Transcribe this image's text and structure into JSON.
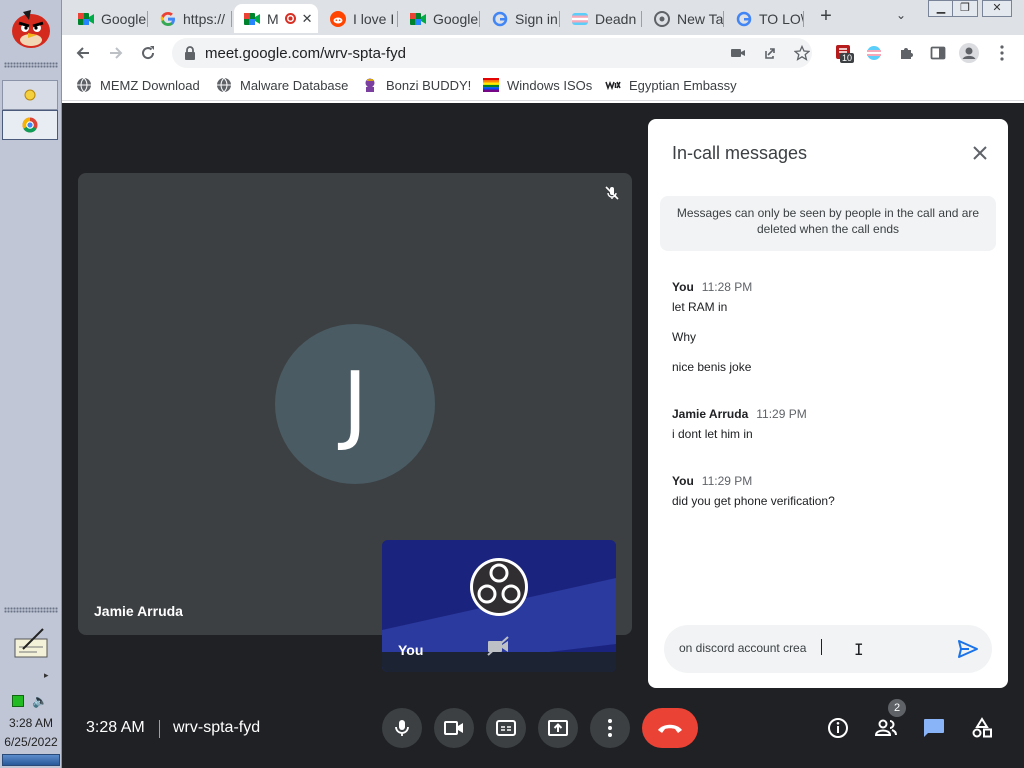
{
  "browser": {
    "tabs": [
      {
        "title": "Google",
        "favicon": "google-meet-icon"
      },
      {
        "title": "https://",
        "favicon": "google-g-icon"
      },
      {
        "title": "M",
        "favicon": "google-meet-icon",
        "active": true,
        "recording": true
      },
      {
        "title": "I love I",
        "favicon": "reddit-icon"
      },
      {
        "title": "Google",
        "favicon": "google-meet-icon"
      },
      {
        "title": "Sign in",
        "favicon": "google-g-icon"
      },
      {
        "title": "Deadn",
        "favicon": "trans-flag-icon"
      },
      {
        "title": "New Ta",
        "favicon": "chrome-icon"
      },
      {
        "title": "TO LO\\",
        "favicon": "google-g-icon"
      }
    ],
    "address": "meet.google.com/wrv-spta-fyd",
    "extension_badge": "10",
    "bookmarks": [
      {
        "label": "MEMZ Download",
        "icon": "globe-icon"
      },
      {
        "label": "Malware Database",
        "icon": "globe-icon"
      },
      {
        "label": "Bonzi BUDDY!",
        "icon": "bonzi-icon"
      },
      {
        "label": "Windows ISOs",
        "icon": "rainbow-flag-icon"
      },
      {
        "label": "Egyptian Embassy",
        "icon": "wix-icon"
      }
    ]
  },
  "taskbar": {
    "time": "3:28 AM",
    "date": "6/25/2022"
  },
  "meet": {
    "main_participant": {
      "name": "Jamie Arruda",
      "initial": "J",
      "muted": true
    },
    "self_tile": {
      "label": "You",
      "camera_off": true
    },
    "meeting_time": "3:28 AM",
    "meeting_code": "wrv-spta-fyd",
    "people_count": "2"
  },
  "chat": {
    "heading": "In-call messages",
    "notice": "Messages can only be seen by people in the call and are deleted when the call ends",
    "groups": [
      {
        "sender": "You",
        "time": "11:28 PM",
        "lines": [
          "let RAM in",
          "Why",
          "nice benis joke"
        ]
      },
      {
        "sender": "Jamie Arruda",
        "time": "11:29 PM",
        "lines": [
          "i dont let him in"
        ]
      },
      {
        "sender": "You",
        "time": "11:29 PM",
        "lines": [
          "did you get phone verification?"
        ]
      }
    ],
    "draft": "on discord account crea"
  },
  "colors": {
    "meet_bg": "#202124",
    "tile_bg": "#3c4043",
    "end_call": "#ea4335",
    "chat_accent": "#1a73e8",
    "self_tile_bg": "#1e2a78"
  }
}
